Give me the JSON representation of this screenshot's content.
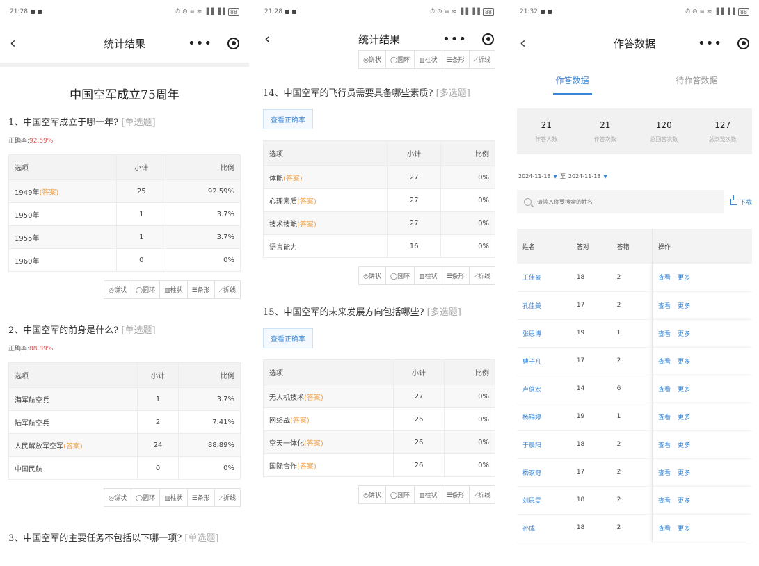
{
  "status_time_1": "21:28",
  "status_time_2": "21:28",
  "status_time_3": "21:32",
  "status_icons": "⏱ ⊙ ≡ ≈ ▐▐ ▐▐",
  "battery": "88",
  "p1": {
    "nav_title": "统计结果",
    "survey_title": "中国空军成立75周年",
    "questions": [
      {
        "text": "1、中国空军成立于哪一年?",
        "type": "[单选题]",
        "rate_label": "正确率:",
        "rate_value": "92.59%",
        "headers": [
          "选项",
          "小计",
          "比例"
        ],
        "rows": [
          {
            "opt": "1949年",
            "ans": "(答案)",
            "count": "25",
            "pct": "92.59%"
          },
          {
            "opt": "1950年",
            "ans": "",
            "count": "1",
            "pct": "3.7%"
          },
          {
            "opt": "1955年",
            "ans": "",
            "count": "1",
            "pct": "3.7%"
          },
          {
            "opt": "1960年",
            "ans": "",
            "count": "0",
            "pct": "0%"
          }
        ]
      },
      {
        "text": "2、中国空军的前身是什么?",
        "type": "[单选题]",
        "rate_label": "正确率:",
        "rate_value": "88.89%",
        "headers": [
          "选项",
          "小计",
          "比例"
        ],
        "rows": [
          {
            "opt": "海军航空兵",
            "ans": "",
            "count": "1",
            "pct": "3.7%"
          },
          {
            "opt": "陆军航空兵",
            "ans": "",
            "count": "2",
            "pct": "7.41%"
          },
          {
            "opt": "人民解放军空军",
            "ans": "(答案)",
            "count": "24",
            "pct": "88.89%"
          },
          {
            "opt": "中国民航",
            "ans": "",
            "count": "0",
            "pct": "0%"
          }
        ]
      }
    ],
    "q3_text": "3、中国空军的主要任务不包括以下哪一项?",
    "q3_type": "[单选题]"
  },
  "chart_switch": [
    "◎饼状",
    "◯圆环",
    "▥柱状",
    "☰条形",
    "⟋折线"
  ],
  "p2": {
    "nav_title": "统计结果",
    "rate_button": "查看正确率",
    "questions": [
      {
        "text": "14、中国空军的飞行员需要具备哪些素质?",
        "type": "[多选题]",
        "headers": [
          "选项",
          "小计",
          "比例"
        ],
        "rows": [
          {
            "opt": "体能",
            "ans": "(答案)",
            "count": "27",
            "pct": "0%"
          },
          {
            "opt": "心理素质",
            "ans": "(答案)",
            "count": "27",
            "pct": "0%"
          },
          {
            "opt": "技术技能",
            "ans": "(答案)",
            "count": "27",
            "pct": "0%"
          },
          {
            "opt": "语言能力",
            "ans": "",
            "count": "16",
            "pct": "0%"
          }
        ]
      },
      {
        "text": "15、中国空军的未来发展方向包括哪些?",
        "type": "[多选题]",
        "headers": [
          "选项",
          "小计",
          "比例"
        ],
        "rows": [
          {
            "opt": "无人机技术",
            "ans": "(答案)",
            "count": "27",
            "pct": "0%"
          },
          {
            "opt": "网络战",
            "ans": "(答案)",
            "count": "26",
            "pct": "0%"
          },
          {
            "opt": "空天一体化",
            "ans": "(答案)",
            "count": "26",
            "pct": "0%"
          },
          {
            "opt": "国际合作",
            "ans": "(答案)",
            "count": "26",
            "pct": "0%"
          }
        ]
      }
    ]
  },
  "p3": {
    "nav_title": "作答数据",
    "tabs": [
      "作答数据",
      "待作答数据"
    ],
    "stats": [
      {
        "num": "21",
        "label": "作答人数"
      },
      {
        "num": "21",
        "label": "作答次数"
      },
      {
        "num": "120",
        "label": "总回答次数"
      },
      {
        "num": "127",
        "label": "总浏览次数"
      }
    ],
    "date_from": "2024-11-18",
    "date_sep": "至",
    "date_to": "2024-11-18",
    "search_placeholder": "请输入你要搜索的姓名",
    "download": "下载",
    "headers": [
      "姓名",
      "答对",
      "答错",
      "操作"
    ],
    "op_view": "查看",
    "op_more": "更多",
    "rows": [
      {
        "name": "王佳豪",
        "right": "18",
        "wrong": "2"
      },
      {
        "name": "孔佳美",
        "right": "17",
        "wrong": "2"
      },
      {
        "name": "张思博",
        "right": "19",
        "wrong": "1"
      },
      {
        "name": "曹子凡",
        "right": "17",
        "wrong": "2"
      },
      {
        "name": "卢俊宏",
        "right": "14",
        "wrong": "6"
      },
      {
        "name": "杨锦婷",
        "right": "19",
        "wrong": "1"
      },
      {
        "name": "于晨阳",
        "right": "18",
        "wrong": "2"
      },
      {
        "name": "杨家奇",
        "right": "17",
        "wrong": "2"
      },
      {
        "name": "刘思雯",
        "right": "18",
        "wrong": "2"
      },
      {
        "name": "孙成",
        "right": "18",
        "wrong": "2"
      }
    ]
  }
}
